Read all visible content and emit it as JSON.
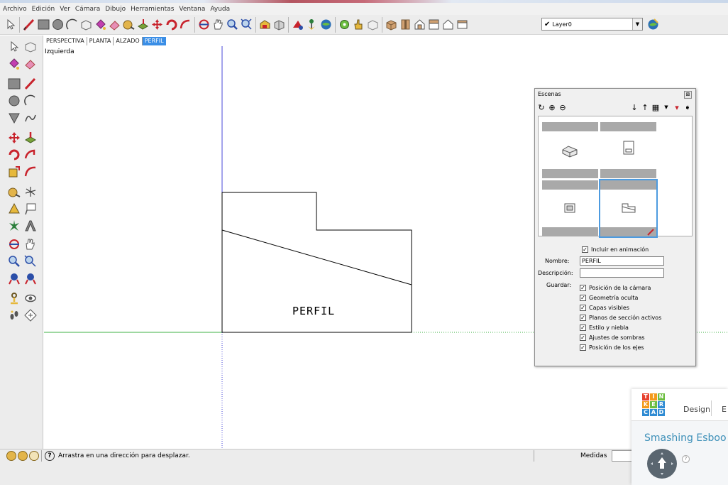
{
  "menubar": {
    "items": [
      "Archivo",
      "Edición",
      "Ver",
      "Cámara",
      "Dibujo",
      "Herramientas",
      "Ventana",
      "Ayuda"
    ]
  },
  "toolbar": {
    "layer_name": "Layer0",
    "layer_checked": "✔"
  },
  "tabs": [
    "PERSPECTIVA",
    "PLANTA",
    "ALZADO",
    "PERFIL"
  ],
  "viewport": {
    "view_label": "Izquierda",
    "drawing_label": "PERFIL"
  },
  "scenes_panel": {
    "title": "Escenas",
    "close": "⊠",
    "include_animation": "Incluir en animación",
    "name_label": "Nombre:",
    "name_value": "PERFIL",
    "description_label": "Descripción:",
    "description_value": "",
    "save_label": "Guardar:",
    "save_options": [
      "Posición de la cámara",
      "Geometría oculta",
      "Capas visibles",
      "Planos de sección activos",
      "Estilo y niebla",
      "Ajustes de sombras",
      "Posición de los ejes"
    ],
    "check": "✓"
  },
  "statusbar": {
    "hint": "Arrastra en una dirección para desplazar.",
    "help": "?",
    "measures_label": "Medidas"
  },
  "tinkercad": {
    "logo_letters": [
      "T",
      "I",
      "N",
      "K",
      "E",
      "R",
      "C",
      "A",
      "D"
    ],
    "design_tab": "Design",
    "cut_tab": "E",
    "title": "Smashing Esboo",
    "help": "?"
  },
  "colors": {
    "accent_blue": "#3a8ee6",
    "axis_green": "#3cb043",
    "axis_blue": "#4a4ad8",
    "tc_red": "#e7402e",
    "tc_orange": "#f39a1b",
    "tc_green": "#6bbd3f",
    "tc_blue": "#2f8bd3",
    "tc_teal": "#3c8fb8"
  }
}
